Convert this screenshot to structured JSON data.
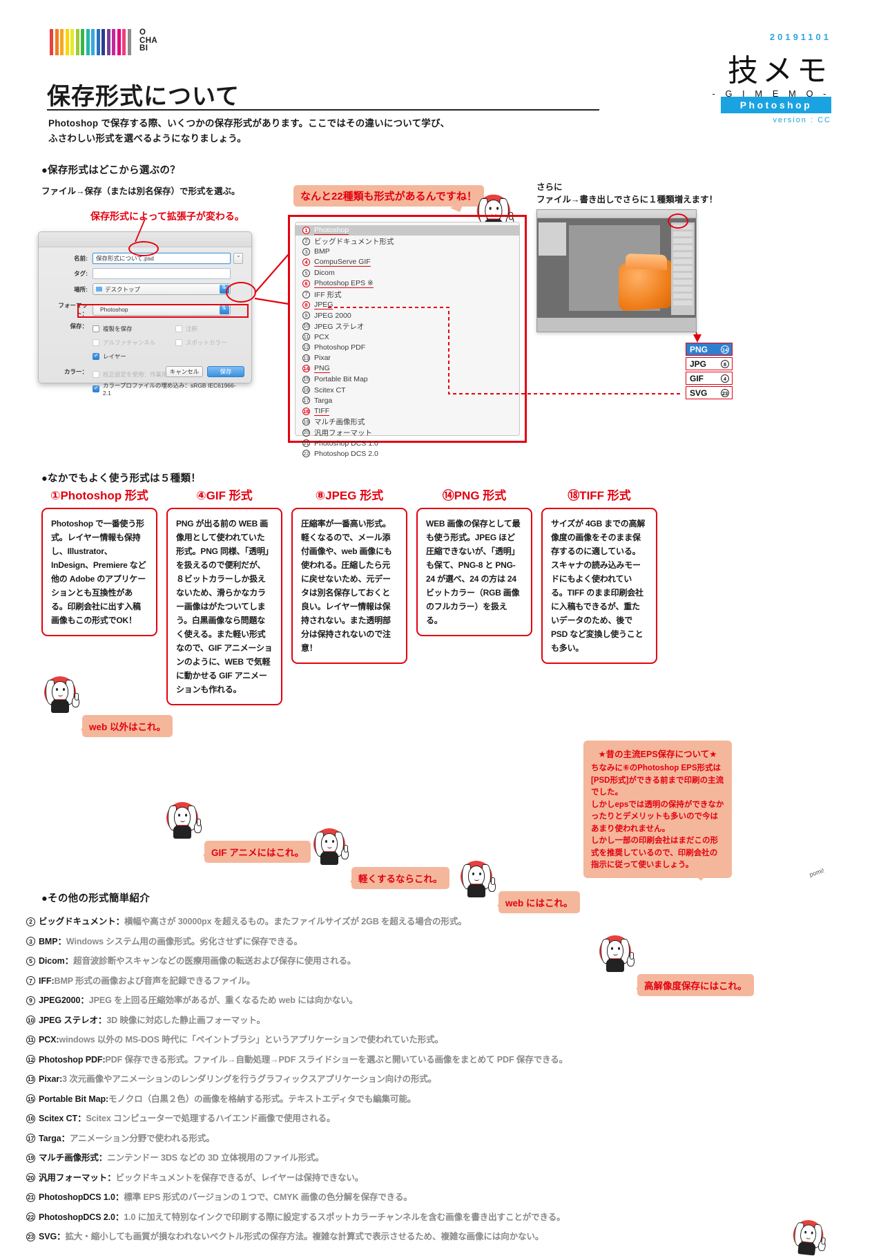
{
  "header": {
    "logo_text_1": "O",
    "logo_text_2": "CHA",
    "logo_text_3": "BI",
    "date": "20191101",
    "gimemo_ja": "技メモ",
    "gimemo_en": "- G I M E M O -",
    "app_badge": "Photoshop",
    "version": "version : CC"
  },
  "title": "保存形式について",
  "lede_line1": "Photoshop で保存する際、いくつかの保存形式があります。ここではその違いについて学び、",
  "lede_line2": "ふさわしい形式を選べるようになりましょう。",
  "section1": {
    "heading": "●保存形式はどこから選ぶの？",
    "subheading": "ファイル→保存（または別名保存）で形式を選ぶ。",
    "note_extension": "保存形式によって拡張子が変わる。",
    "bubble_22": "なんと22種類も形式があるんですね！",
    "export_note_line1": "さらに",
    "export_note_line2": "ファイル→書き出しでさらに１種類増えます！"
  },
  "dialog": {
    "name_label": "名前:",
    "name_value": "保存形式について.psd",
    "tag_label": "タグ:",
    "tag_value": "",
    "place_label": "場所:",
    "place_value": "デスクトップ",
    "format_label": "フォーマット：",
    "format_value": "Photoshop",
    "save_label": "保存：",
    "cb_copy": "複製を保存",
    "cb_annotation": "注釈",
    "cb_alpha": "アルファチャンネル",
    "cb_spot": "スポットカラー",
    "cb_layers": "レイヤー",
    "color_label": "カラー：",
    "cb_proof": "校正設定を使用：作業用 CMYK",
    "cb_profile": "カラープロファイルの埋め込み：sRGB IEC61966-2.1",
    "btn_cancel": "キャンセル",
    "btn_save": "保存"
  },
  "format_list": [
    {
      "n": "1",
      "label": "Photoshop",
      "selected": true,
      "highlight": true
    },
    {
      "n": "2",
      "label": "ビッグドキュメント形式"
    },
    {
      "n": "3",
      "label": "BMP"
    },
    {
      "n": "4",
      "label": "CompuServe GIF",
      "highlight": true
    },
    {
      "n": "5",
      "label": "Dicom"
    },
    {
      "n": "6",
      "label": "Photoshop EPS ※",
      "highlight": true
    },
    {
      "n": "7",
      "label": "IFF 形式"
    },
    {
      "n": "8",
      "label": "JPEG",
      "highlight": true
    },
    {
      "n": "9",
      "label": "JPEG 2000"
    },
    {
      "n": "10",
      "label": "JPEG ステレオ"
    },
    {
      "n": "11",
      "label": "PCX"
    },
    {
      "n": "12",
      "label": "Photoshop PDF"
    },
    {
      "n": "13",
      "label": "Pixar"
    },
    {
      "n": "14",
      "label": "PNG",
      "highlight": true
    },
    {
      "n": "15",
      "label": "Portable Bit Map"
    },
    {
      "n": "16",
      "label": "Scitex CT"
    },
    {
      "n": "17",
      "label": "Targa"
    },
    {
      "n": "18",
      "label": "TIFF",
      "highlight": true
    },
    {
      "n": "19",
      "label": "マルチ画像形式"
    },
    {
      "n": "20",
      "label": "汎用フォーマット"
    },
    {
      "n": "21",
      "label": "Photoshop DCS 1.0"
    },
    {
      "n": "22",
      "label": "Photoshop DCS 2.0"
    }
  ],
  "badges": [
    {
      "label": "PNG",
      "n": "14",
      "active": true
    },
    {
      "label": "JPG",
      "n": "8",
      "active": false
    },
    {
      "label": "GIF",
      "n": "4",
      "active": false
    },
    {
      "label": "SVG",
      "n": "23",
      "active": false
    }
  ],
  "section2": {
    "heading": "●なかでもよく使う形式は５種類！"
  },
  "cards": [
    {
      "title": "①Photoshop 形式",
      "body": "Photoshop で一番使う形式。レイヤー情報も保持し、Illustrator、InDesign、Premiere など他の Adobe のアプリケーションとも互換性がある。印刷会社に出す入稿画像もこの形式でOK！",
      "say": "web 以外はこれ。"
    },
    {
      "title": "④GIF 形式",
      "body": "PNG が出る前の WEB 画像用として使われていた形式。PNG 同様、「透明」を扱えるので便利だが、８ビットカラーしか扱えないため、滑らかなカラー画像はがたついてしまう。白黒画像なら問題なく使える。また軽い形式なので、GIF アニメーションのように、WEB で気軽に動かせる GIF アニメーションも作れる。",
      "say": "GIF アニメにはこれ。"
    },
    {
      "title": "⑧JPEG 形式",
      "body": "圧縮率が一番高い形式。軽くなるので、メール添付画像や、web 画像にも使われる。圧縮したら元に戻せないため、元データは別名保存しておくと良い。レイヤー情報は保持されない。また透明部分は保持されないので注意！",
      "say": "軽くするならこれ。"
    },
    {
      "title": "⑭PNG 形式",
      "body": "WEB 画像の保存として最も使う形式。JPEG ほど圧縮できないが、「透明」も保て、PNG-8 と PNG-24 が選べ、24 の方は 24 ビットカラー（RGB 画像のフルカラー）を扱える。",
      "say": "web にはこれ。"
    },
    {
      "title": "⑱TIFF 形式",
      "body": "サイズが 4GB までの高解像度の画像をそのまま保存するのに適している。スキャナの読み込みモードにもよく使われている。TIFF のまま印刷会社に入稿もできるが、重たいデータのため、後で PSD など変換し使うことも多い。",
      "say": "高解像度保存にはこれ。"
    }
  ],
  "eps_note": {
    "heading": "★昔の主流EPS保存について★",
    "body": "ちなみに⑥のPhotoshop EPS形式は[PSD形式]ができる前まで印刷の主流でした。\nしかしepsでは透明の保持ができなかったりとデメリットも多いので今はあまり使われません。\nしかし一部の印刷会社はまだこの形式を推奨しているので、印刷会社の指示に従って使いましょう。",
    "mascot_sfx": "pomi!"
  },
  "section3": {
    "heading": "●その他の形式簡単紹介"
  },
  "others": [
    {
      "n": "2",
      "key": "ビッグドキュメント：",
      "desc": "横幅や高さが 30000px を超えるもの。またファイルサイズが 2GB を超える場合の形式。"
    },
    {
      "n": "3",
      "key": "BMP：",
      "desc": "Windows システム用の画像形式。劣化させずに保存できる。"
    },
    {
      "n": "5",
      "key": "Dicom：",
      "desc": "超音波診断やスキャンなどの医療用画像の転送および保存に使用される。"
    },
    {
      "n": "7",
      "key": "IFF:",
      "desc": "BMP 形式の画像および音声を記録できるファイル。"
    },
    {
      "n": "9",
      "key": "JPEG2000：",
      "desc": "JPEG を上回る圧縮効率があるが、重くなるため web には向かない。"
    },
    {
      "n": "10",
      "key": "JPEG ステレオ：",
      "desc": "3D 映像に対応した静止画フォーマット。"
    },
    {
      "n": "11",
      "key": "PCX:",
      "desc": "windows 以外の MS-DOS 時代に「ペイントブラシ」というアプリケーションで使われていた形式。"
    },
    {
      "n": "12",
      "key": "Photoshop PDF:",
      "desc": "PDF 保存できる形式。ファイル→自動処理→PDF スライドショーを選ぶと開いている画像をまとめて PDF 保存できる。"
    },
    {
      "n": "13",
      "key": "Pixar:",
      "desc": "3 次元画像やアニメーションのレンダリングを行うグラフィックスアプリケーション向けの形式。"
    },
    {
      "n": "15",
      "key": "Portable Bit Map:",
      "desc": "モノクロ（白黒２色）の画像を格納する形式。テキストエディタでも編集可能。"
    },
    {
      "n": "16",
      "key": "Scitex CT：",
      "desc": "Scitex コンピューターで処理するハイエンド画像で使用される。"
    },
    {
      "n": "17",
      "key": "Targa：",
      "desc": "アニメーション分野で使われる形式。"
    },
    {
      "n": "19",
      "key": "マルチ画像形式：",
      "desc": "ニンテンドー 3DS などの 3D 立体視用のファイル形式。"
    },
    {
      "n": "20",
      "key": "汎用フォーマット：",
      "desc": "ビックドキュメントを保存できるが、レイヤーは保持できない。"
    },
    {
      "n": "21",
      "key": "PhotoshopDCS 1.0：",
      "desc": "標準 EPS 形式のバージョンの１つで、CMYK 画像の色分解を保存できる。"
    },
    {
      "n": "22",
      "key": "PhotoshopDCS 2.0：",
      "desc": "1.0 に加えて特別なインクで印刷する際に設定するスポットカラーチャンネルを含む画像を書き出すことができる。"
    },
    {
      "n": "23",
      "key": "SVG：",
      "desc": "拡大・縮小しても画質が損なわれないベクトル形式の保存方法。複雑な計算式で表示させるため、複雑な画像には向かない。"
    }
  ],
  "colors": {
    "red": "#e3000f",
    "peach": "#f4b79b",
    "blue": "#1aa3e0",
    "gray": "#8a8a8a"
  }
}
